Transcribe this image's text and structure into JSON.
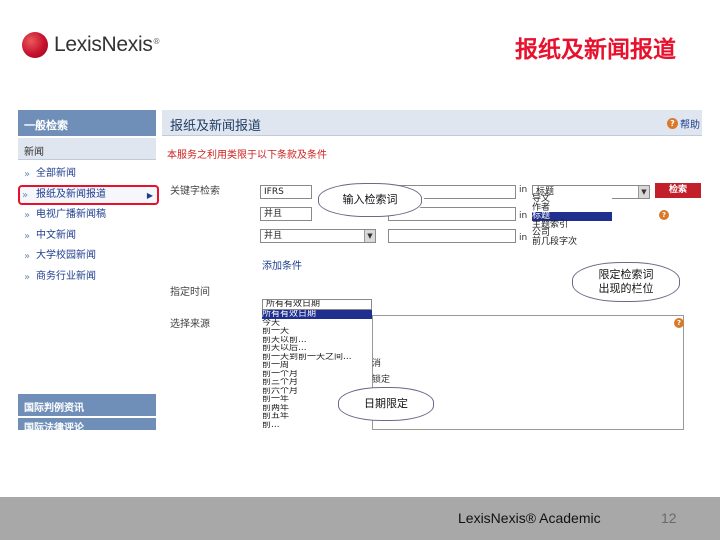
{
  "brand": {
    "logo_text": "LexisNexis",
    "trademark": "®"
  },
  "slide_title": "报纸及新闻报道",
  "sidebar": {
    "header": "一般检索",
    "subheader": "新闻",
    "items": [
      {
        "label": "全部新闻",
        "active": false
      },
      {
        "label": "报纸及新闻报道",
        "active": true
      },
      {
        "label": "电视广播新闻稿",
        "active": false
      },
      {
        "label": "中文新闻",
        "active": false
      },
      {
        "label": "大学校园新闻",
        "active": false
      },
      {
        "label": "商务行业新闻",
        "active": false
      }
    ],
    "footer_items": [
      "国际判例资讯",
      "国际法律评论"
    ]
  },
  "panel": {
    "title": "报纸及新闻报道",
    "help_label": "帮助",
    "restriction_text": "本服务之利用类限于以下条款及条件",
    "keyword_label": "关键字检索",
    "keyword_rows": [
      {
        "value": "IFRS",
        "connector": "",
        "in_label": "in"
      },
      {
        "value": "并且",
        "connector": "",
        "in_label": "in"
      },
      {
        "value": "并且",
        "connector": "",
        "in_label": "in"
      }
    ],
    "field_select_value": "标题",
    "field_options": [
      "标题",
      "导文",
      "作者",
      "标题",
      "主题索引",
      "公司",
      "前几段字次"
    ],
    "field_highlight_index": 3,
    "search_button": "检索",
    "add_condition": "添加条件",
    "date_label": "指定时间",
    "date_select_value": "所有有效日期",
    "date_options": [
      "所有有效日期",
      "今天",
      "昨天",
      "前一天",
      "前天以前...",
      "前天以后...",
      "前一天到前一天之间...",
      "前一周",
      "前一个月",
      "前三个月",
      "前六个月",
      "前一年",
      "前两年",
      "前五年",
      "前..."
    ],
    "date_highlight_index": 1,
    "source_label": "选择来源",
    "source_hint_a": "消",
    "source_hint_b": "锁定"
  },
  "callouts": {
    "keyword": "输入检索词",
    "field": "限定检索词\n出现的栏位",
    "date": "日期限定"
  },
  "footer": {
    "brand_text": "LexisNexis® Academic",
    "page_number": "12"
  },
  "colors": {
    "accent_red": "#e8112d",
    "sidebar_blue": "#6f8fb8",
    "highlight_navy": "#1f2f8f",
    "footer_gray": "#a8a8a8"
  },
  "icons": [
    "logo-mark-icon",
    "help-icon",
    "dropdown-arrow-icon",
    "warning-icon",
    "bullet-icon",
    "chevron-right-icon"
  ]
}
